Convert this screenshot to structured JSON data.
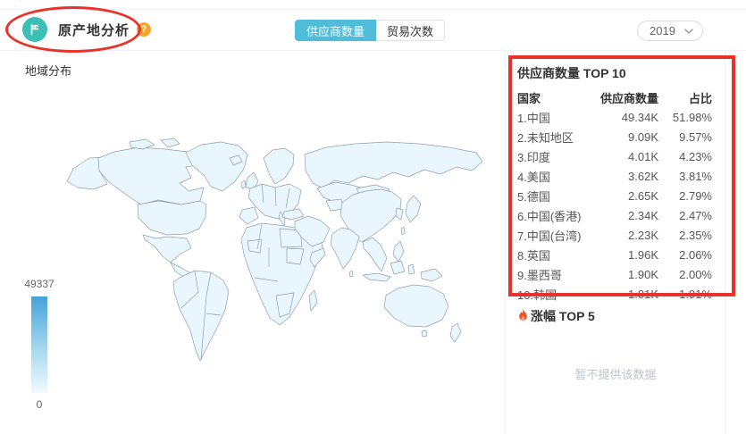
{
  "header": {
    "title": "原产地分析",
    "help": "?",
    "tabs": [
      {
        "label": "供应商数量",
        "active": true
      },
      {
        "label": "贸易次数",
        "active": false
      }
    ],
    "year": "2019"
  },
  "map_section": {
    "title": "地域分布",
    "legend": {
      "max": "49337",
      "min": "0"
    },
    "highlighted_country": "中国"
  },
  "supplier_top10": {
    "title": "供应商数量 TOP 10",
    "columns": [
      "国家",
      "供应商数量",
      "占比"
    ],
    "rows": [
      {
        "country": "1.中国",
        "count": "49.34K",
        "share": "51.98%"
      },
      {
        "country": "2.未知地区",
        "count": "9.09K",
        "share": "9.57%"
      },
      {
        "country": "3.印度",
        "count": "4.01K",
        "share": "4.23%"
      },
      {
        "country": "4.美国",
        "count": "3.62K",
        "share": "3.81%"
      },
      {
        "country": "5.德国",
        "count": "2.65K",
        "share": "2.79%"
      },
      {
        "country": "6.中国(香港)",
        "count": "2.34K",
        "share": "2.47%"
      },
      {
        "country": "7.中国(台湾)",
        "count": "2.23K",
        "share": "2.35%"
      },
      {
        "country": "8.英国",
        "count": "1.96K",
        "share": "2.06%"
      },
      {
        "country": "9.墨西哥",
        "count": "1.90K",
        "share": "2.00%"
      },
      {
        "country": "10.韩国",
        "count": "1.81K",
        "share": "1.91%"
      }
    ]
  },
  "growth_top5": {
    "title": "涨幅 TOP 5",
    "empty_text": "暂不提供该数据"
  },
  "colors": {
    "annotation_red": "#E8322A",
    "brand_teal": "#3CBFB4",
    "active_tab_blue": "#4FBCD9",
    "map_highlight_blue": "#3E90CA",
    "legend_gradient_top": "#44A3DA",
    "legend_gradient_bottom": "#F0FAFE"
  }
}
